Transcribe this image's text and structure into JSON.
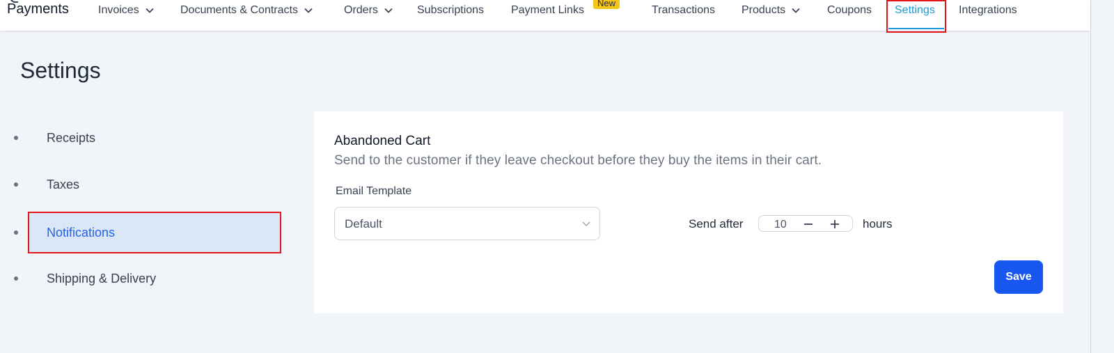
{
  "app": {
    "brand": "Payments"
  },
  "nav": {
    "items": [
      {
        "label": "Invoices",
        "has_dropdown": true
      },
      {
        "label": "Documents & Contracts",
        "has_dropdown": true
      },
      {
        "label": "Orders",
        "has_dropdown": true
      },
      {
        "label": "Subscriptions",
        "has_dropdown": false
      },
      {
        "label": "Payment Links",
        "has_dropdown": false,
        "badge": "New"
      },
      {
        "label": "Transactions",
        "has_dropdown": false
      },
      {
        "label": "Products",
        "has_dropdown": true
      },
      {
        "label": "Coupons",
        "has_dropdown": false
      },
      {
        "label": "Settings",
        "has_dropdown": false,
        "active": true
      },
      {
        "label": "Integrations",
        "has_dropdown": false
      }
    ]
  },
  "page": {
    "title": "Settings"
  },
  "sidebar": {
    "items": [
      {
        "label": "Receipts"
      },
      {
        "label": "Taxes"
      },
      {
        "label": "Notifications",
        "selected": true
      },
      {
        "label": "Shipping & Delivery"
      }
    ]
  },
  "panel": {
    "title": "Abandoned Cart",
    "description": "Send to the customer if they leave checkout before they buy the items in their cart.",
    "email_template": {
      "label": "Email Template",
      "value": "Default"
    },
    "send_after": {
      "label": "Send after",
      "value": "10",
      "unit": "hours"
    },
    "save_label": "Save"
  },
  "colors": {
    "accent": "#1a9bd7",
    "primary_button": "#1756ef",
    "selected_bg": "#dbe7f7",
    "highlight_border": "#e0161b",
    "badge": "#f5c518"
  }
}
